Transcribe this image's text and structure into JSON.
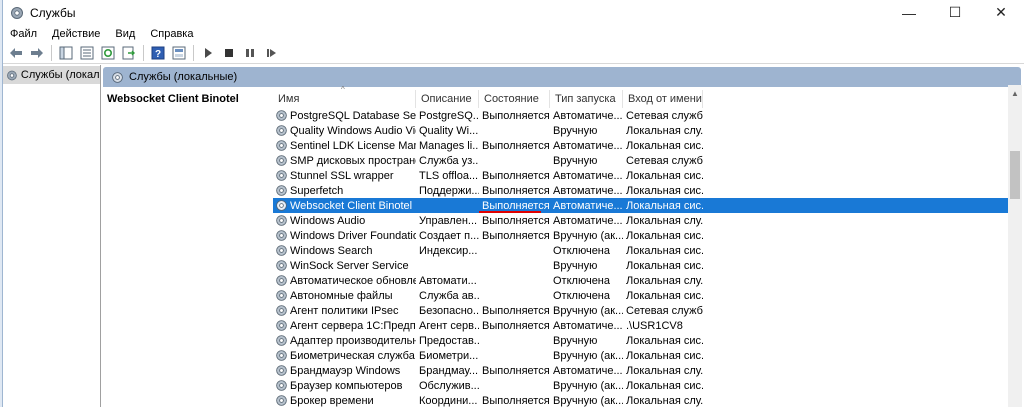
{
  "window": {
    "title": "Службы",
    "controls": {
      "minimize": "—",
      "maximize": "☐",
      "close": "✕"
    }
  },
  "menu": [
    "Файл",
    "Действие",
    "Вид",
    "Справка"
  ],
  "toolbar_icons": [
    "back-icon",
    "forward-icon",
    "console-tree-icon",
    "properties-icon",
    "refresh-icon",
    "export-icon",
    "help-icon",
    "view-icon",
    "play-icon",
    "stop-icon",
    "pause-icon",
    "restart-icon"
  ],
  "tree": {
    "item": "Службы (локалы"
  },
  "pane": {
    "header": "Службы (локальные)",
    "selected_service": "Websocket Client Binotel"
  },
  "table": {
    "columns": [
      "Имя",
      "Описание",
      "Состояние",
      "Тип запуска",
      "Вход от имени"
    ],
    "rows": [
      [
        "PostgreSQL Database Server...",
        "PostgreSQ...",
        "Выполняется",
        "Автоматиче...",
        "Сетевая служба"
      ],
      [
        "Quality Windows Audio Vid...",
        "Quality Wi...",
        "",
        "Вручную",
        "Локальная слу..."
      ],
      [
        "Sentinel LDK License Mana...",
        "Manages li...",
        "Выполняется",
        "Автоматиче...",
        "Локальная сис..."
      ],
      [
        "SMP дисковых пространст...",
        "Служба уз...",
        "",
        "Вручную",
        "Сетевая служба"
      ],
      [
        "Stunnel SSL wrapper",
        "TLS offloa...",
        "Выполняется",
        "Автоматиче...",
        "Локальная сис..."
      ],
      [
        "Superfetch",
        "Поддержи...",
        "Выполняется",
        "Автоматиче...",
        "Локальная сис..."
      ],
      [
        "Websocket Client Binotel",
        "",
        "Выполняется",
        "Автоматиче...",
        "Локальная сис..."
      ],
      [
        "Windows Audio",
        "Управлен...",
        "Выполняется",
        "Автоматиче...",
        "Локальная слу..."
      ],
      [
        "Windows Driver Foundation...",
        "Создает п...",
        "Выполняется",
        "Вручную (ак...",
        "Локальная сис..."
      ],
      [
        "Windows Search",
        "Индексир...",
        "",
        "Отключена",
        "Локальная сис..."
      ],
      [
        "WinSock Server Service",
        "",
        "",
        "Вручную",
        "Локальная сис..."
      ],
      [
        "Автоматическое обновле...",
        "Автомати...",
        "",
        "Отключена",
        "Локальная слу..."
      ],
      [
        "Автономные файлы",
        "Служба ав...",
        "",
        "Отключена",
        "Локальная сис..."
      ],
      [
        "Агент политики IPsec",
        "Безопасно...",
        "Выполняется",
        "Вручную (ак...",
        "Сетевая служба"
      ],
      [
        "Агент сервера 1С:Предпри...",
        "Агент серв...",
        "Выполняется",
        "Автоматиче...",
        ".\\USR1CV8"
      ],
      [
        "Адаптер производительно...",
        "Предостав...",
        "",
        "Вручную",
        "Локальная сис..."
      ],
      [
        "Биометрическая служба ...",
        "Биометри...",
        "",
        "Вручную (ак...",
        "Локальная сис..."
      ],
      [
        "Брандмауэр Windows",
        "Брандмау...",
        "Выполняется",
        "Автоматиче...",
        "Локальная слу..."
      ],
      [
        "Браузер компьютеров",
        "Обслужив...",
        "",
        "Вручную (ак...",
        "Локальная сис..."
      ],
      [
        "Брокер времени",
        "Координи...",
        "Выполняется",
        "Вручную (ак...",
        "Локальная слу..."
      ]
    ],
    "selected_index": 6
  },
  "colors": {
    "selection": "#1979d6",
    "header_band": "#9eb4d0",
    "underline": "#e00000"
  }
}
